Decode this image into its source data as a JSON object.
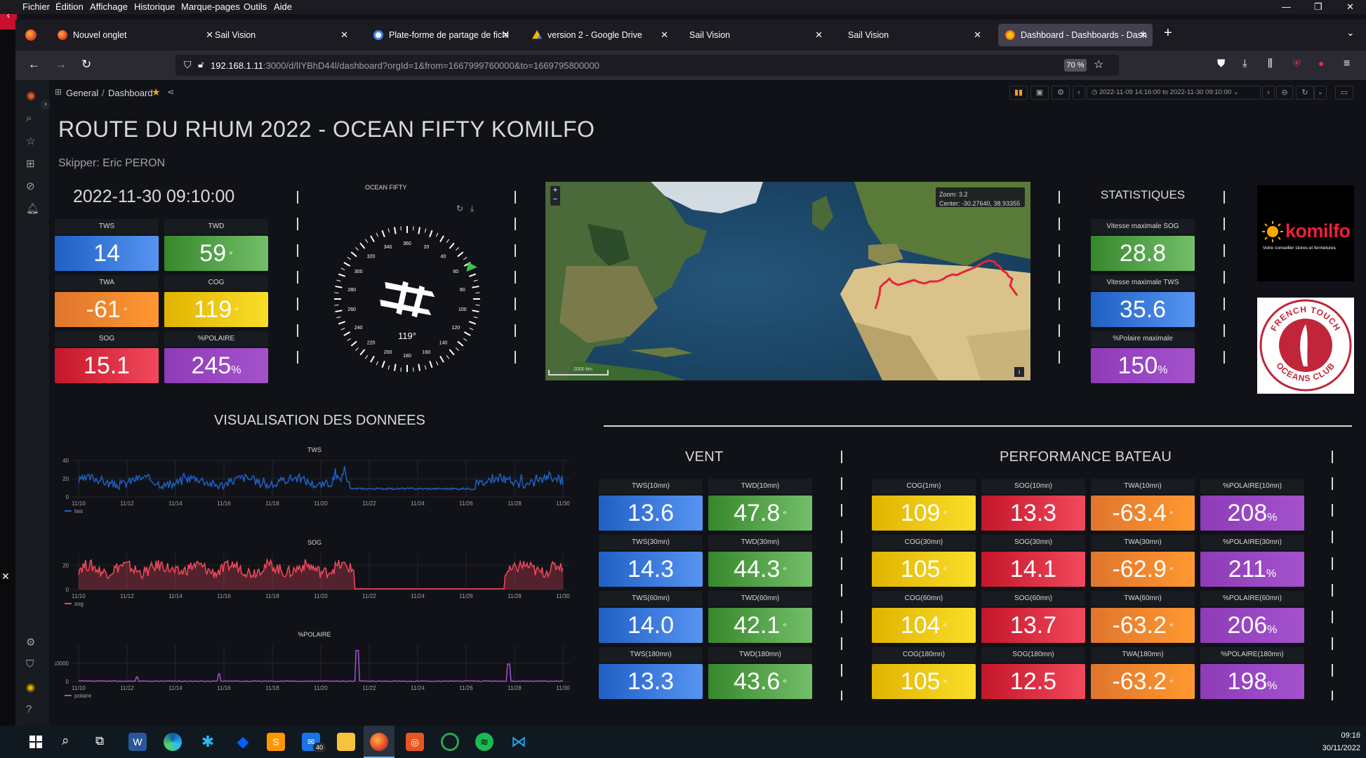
{
  "menubar": {
    "items": [
      "Fichier",
      "Édition",
      "Affichage",
      "Historique",
      "Marque-pages",
      "Outils",
      "Aide"
    ]
  },
  "tabs": [
    {
      "label": "Nouvel onglet",
      "icon": "firefox-icon"
    },
    {
      "label": "Sail Vision",
      "icon": ""
    },
    {
      "label": "Plate-forme de partage de fichi",
      "icon": "google-icon"
    },
    {
      "label": "version 2 - Google Drive",
      "icon": "drive-icon"
    },
    {
      "label": "Sail Vision",
      "icon": ""
    },
    {
      "label": "Sail Vision",
      "icon": ""
    },
    {
      "label": "Dashboard - Dashboards - Dash",
      "icon": "grafana-icon"
    }
  ],
  "navbar": {
    "url_host": "192.168.1.11",
    "url_rest": ":3000/d/lIYBhD44l/dashboard?orgId=1&from=1667999760000&to=1669795800000",
    "zoom": "70 %"
  },
  "grafana": {
    "breadcrumb_folder": "General",
    "breadcrumb_sep": "/",
    "breadcrumb_dashboard": "Dashboard",
    "time_range": "2022-11-09 14:16:00 to 2022-11-30 09:10:00"
  },
  "dashboard": {
    "title": "ROUTE DU RHUM 2022 - OCEAN FIFTY KOMILFO",
    "skipper": "Skipper: Eric PERON",
    "datetime": "2022-11-30 09:10:00",
    "compass_title": "OCEAN FIFTY",
    "compass_heading": "119°",
    "compass_labels": [
      "360",
      "20",
      "40",
      "60",
      "80",
      "100",
      "120",
      "140",
      "160",
      "180",
      "200",
      "220",
      "240",
      "260",
      "280",
      "300",
      "320",
      "340"
    ],
    "map_zoom": "Zoom:  3.2",
    "map_center": "Center: -30.27640, 38.93355",
    "map_scale": "2000 km",
    "stats_title": "STATISTIQUES",
    "viz_title": "VISUALISATION DES DONNEES",
    "vent_title": "VENT",
    "perf_title": "PERFORMANCE BATEAU",
    "komilfo_logo": "komilfo",
    "komilfo_tagline": "Votre conseiller stores et fermetures",
    "ftoc_top": "FRENCH TOUCH",
    "ftoc_bottom": "OCEANS CLUB"
  },
  "current": [
    {
      "label": "TWS",
      "value": "14",
      "unit": "",
      "color": "blue"
    },
    {
      "label": "TWD",
      "value": "59",
      "unit": "°",
      "color": "green"
    },
    {
      "label": "TWA",
      "value": "-61",
      "unit": "°",
      "color": "orange"
    },
    {
      "label": "COG",
      "value": "119",
      "unit": "°",
      "color": "yellow"
    },
    {
      "label": "SOG",
      "value": "15.1",
      "unit": "",
      "color": "red"
    },
    {
      "label": "%POLAIRE",
      "value": "245",
      "unit": "%",
      "color": "purple"
    }
  ],
  "statistiques": [
    {
      "label": "Vitesse maximale SOG",
      "value": "28.8",
      "unit": "",
      "color": "green"
    },
    {
      "label": "Vitesse maximale TWS",
      "value": "35.6",
      "unit": "",
      "color": "blue"
    },
    {
      "label": "%Polaire maximale",
      "value": "150",
      "unit": "%",
      "color": "purple"
    }
  ],
  "vent": [
    {
      "label": "TWS(10mn)",
      "value": "13.6",
      "unit": "",
      "color": "blue"
    },
    {
      "label": "TWD(10mn)",
      "value": "47.8",
      "unit": "°",
      "color": "green"
    },
    {
      "label": "TWS(30mn)",
      "value": "14.3",
      "unit": "",
      "color": "blue"
    },
    {
      "label": "TWD(30mn)",
      "value": "44.3",
      "unit": "°",
      "color": "green"
    },
    {
      "label": "TWS(60mn)",
      "value": "14.0",
      "unit": "",
      "color": "blue"
    },
    {
      "label": "TWD(60mn)",
      "value": "42.1",
      "unit": "°",
      "color": "green"
    },
    {
      "label": "TWS(180mn)",
      "value": "13.3",
      "unit": "",
      "color": "blue"
    },
    {
      "label": "TWD(180mn)",
      "value": "43.6",
      "unit": "°",
      "color": "green"
    }
  ],
  "performance": [
    {
      "label": "COG(1mn)",
      "value": "109",
      "unit": "°",
      "color": "yellow"
    },
    {
      "label": "SOG(10mn)",
      "value": "13.3",
      "unit": "",
      "color": "red"
    },
    {
      "label": "TWA(10mn)",
      "value": "-63.4",
      "unit": "°",
      "color": "orange"
    },
    {
      "label": "%POLAIRE(10mn)",
      "value": "208",
      "unit": "%",
      "color": "purple"
    },
    {
      "label": "COG(30mn)",
      "value": "105",
      "unit": "°",
      "color": "yellow"
    },
    {
      "label": "SOG(30mn)",
      "value": "14.1",
      "unit": "",
      "color": "red"
    },
    {
      "label": "TWA(30mn)",
      "value": "-62.9",
      "unit": "°",
      "color": "orange"
    },
    {
      "label": "%POLAIRE(30mn)",
      "value": "211",
      "unit": "%",
      "color": "purple"
    },
    {
      "label": "COG(60mn)",
      "value": "104",
      "unit": "°",
      "color": "yellow"
    },
    {
      "label": "SOG(60mn)",
      "value": "13.7",
      "unit": "",
      "color": "red"
    },
    {
      "label": "TWA(60mn)",
      "value": "-63.2",
      "unit": "°",
      "color": "orange"
    },
    {
      "label": "%POLAIRE(60mn)",
      "value": "206",
      "unit": "%",
      "color": "purple"
    },
    {
      "label": "COG(180mn)",
      "value": "105",
      "unit": "°",
      "color": "yellow"
    },
    {
      "label": "SOG(180mn)",
      "value": "12.5",
      "unit": "",
      "color": "red"
    },
    {
      "label": "TWA(180mn)",
      "value": "-63.2",
      "unit": "°",
      "color": "orange"
    },
    {
      "label": "%POLAIRE(180mn)",
      "value": "198",
      "unit": "%",
      "color": "purple"
    }
  ],
  "chart_data": [
    {
      "type": "line",
      "title": "TWS",
      "x": [
        "11/10",
        "11/12",
        "11/14",
        "11/16",
        "11/18",
        "11/20",
        "11/22",
        "11/24",
        "11/26",
        "11/28",
        "11/30"
      ],
      "yticks": [
        "0",
        "20",
        "40"
      ],
      "ylim": [
        0,
        40
      ],
      "series": [
        {
          "name": "tws",
          "color": "#1f60c4"
        }
      ]
    },
    {
      "type": "area",
      "title": "SOG",
      "x": [
        "11/10",
        "11/12",
        "11/14",
        "11/16",
        "11/18",
        "11/20",
        "11/22",
        "11/24",
        "11/26",
        "11/28",
        "11/30"
      ],
      "yticks": [
        "0",
        "20"
      ],
      "ylim": [
        0,
        30
      ],
      "series": [
        {
          "name": "sog",
          "color": "#f2495c"
        }
      ]
    },
    {
      "type": "line",
      "title": "%POLAIRE",
      "x": [
        "11/10",
        "11/12",
        "11/14",
        "11/16",
        "11/18",
        "11/20",
        "11/22",
        "11/24",
        "11/26",
        "11/28",
        "11/30"
      ],
      "yticks": [
        "0",
        "10000"
      ],
      "ylim": [
        0,
        20000
      ],
      "series": [
        {
          "name": "polaire",
          "color": "#a352cc"
        }
      ]
    }
  ],
  "taskbar": {
    "time": "09:16",
    "date": "30/11/2022",
    "mail_badge": "40"
  }
}
